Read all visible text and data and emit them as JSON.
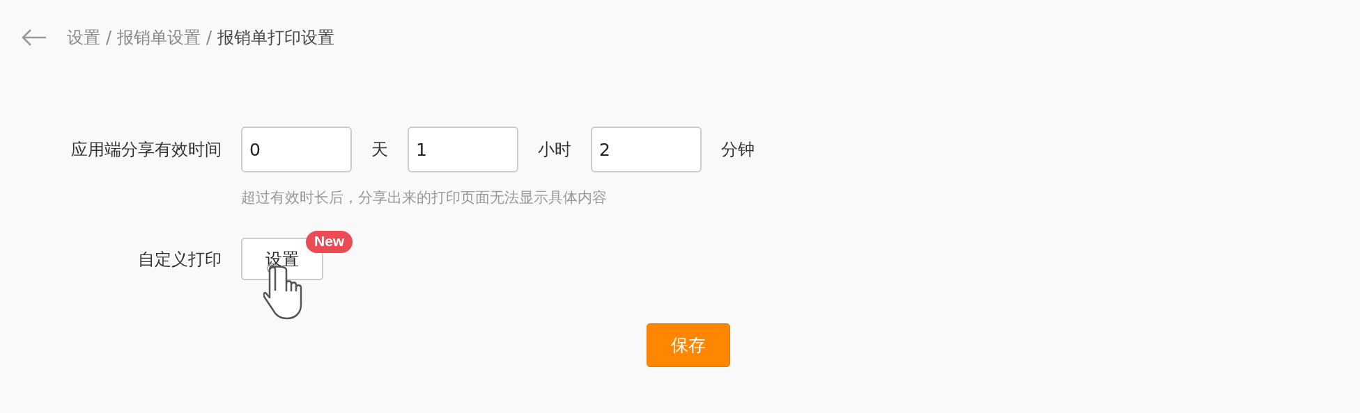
{
  "breadcrumb": [
    {
      "label": "设置",
      "kind": "link"
    },
    {
      "label": "/",
      "kind": "separator"
    },
    {
      "label": "报销单设置",
      "kind": "link"
    },
    {
      "label": "/",
      "kind": "separator"
    },
    {
      "label": "报销单打印设置",
      "kind": "current"
    }
  ],
  "share_validity": {
    "label": "应用端分享有效时间",
    "fields": [
      {
        "value": "0",
        "unit": "天"
      },
      {
        "value": "1",
        "unit": "小时"
      },
      {
        "value": "2",
        "unit": "分钟"
      }
    ],
    "hint": "超过有效时长后，分享出来的打印页面无法显示具体内容"
  },
  "custom_print": {
    "label": "自定义打印",
    "button": "设置",
    "badge": "New"
  },
  "save_button": "保存"
}
